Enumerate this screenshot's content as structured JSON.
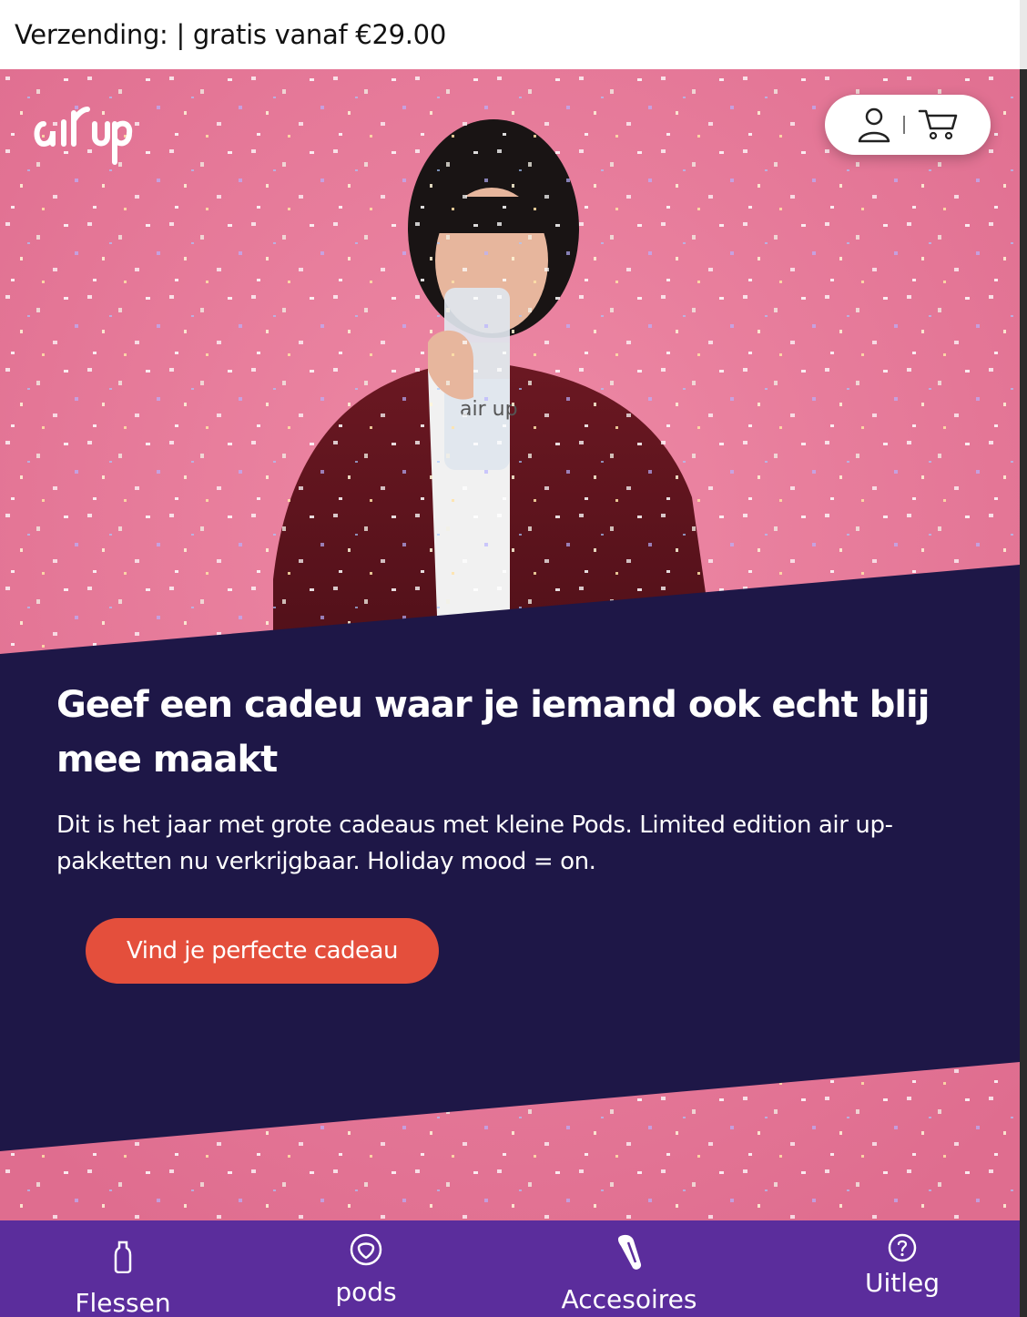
{
  "shipping": {
    "text": "Verzending: | gratis vanaf €29.00"
  },
  "brand": {
    "logo_text": "air up",
    "accent": "#e44f3c",
    "navy": "#1e1747",
    "pink": "#e87896",
    "purple": "#5b2d9c"
  },
  "header": {
    "account_icon": "user-icon",
    "cart_icon": "cart-icon"
  },
  "hero": {
    "headline": "Geef een cadeu waar je iemand ook echt blij mee maakt",
    "subtext": "Dit is het jaar met grote cadeaus met kleine Pods. Limited edition air up-pakketten nu verkrijgbaar. Holiday mood = on.",
    "cta_label": "Vind je perfecte cadeau"
  },
  "bottom_nav": {
    "items": [
      {
        "label": "Flessen",
        "icon": "bottle-icon"
      },
      {
        "label": "pods",
        "icon": "pod-icon"
      },
      {
        "label": "Accesoires",
        "icon": "accessory-icon"
      },
      {
        "label": "Uitleg",
        "icon": "help-icon"
      }
    ]
  }
}
